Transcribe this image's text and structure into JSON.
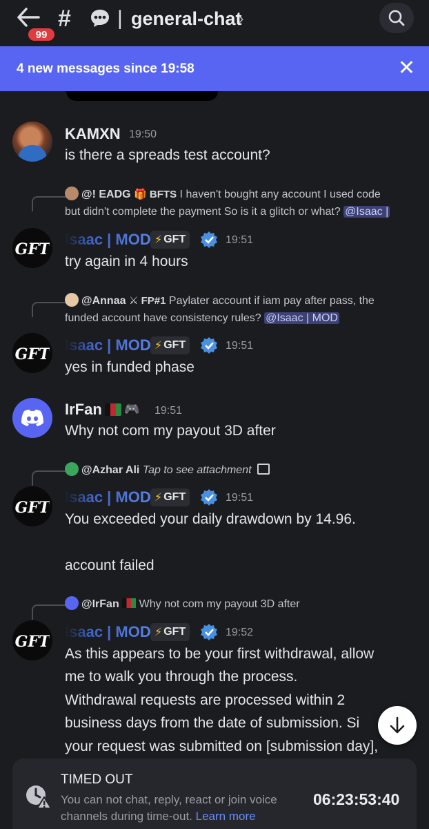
{
  "header": {
    "unread_count": "99",
    "hash": "#",
    "separator": "|",
    "channel_name": "general-chat",
    "chevron": "›"
  },
  "banner": {
    "text": "4 new messages since 19:58",
    "close": "✕"
  },
  "messages": [
    {
      "author": "KAMXN",
      "time": "19:50",
      "lines": [
        "is there a spreads test account?"
      ]
    },
    {
      "reply": {
        "author": "@! EADG",
        "tag": "BFTS",
        "line1": "I haven't bought any account  I used code",
        "line2": "but didn't complete the payment So is it a glitch or what?",
        "mention": "@Isaac |"
      },
      "author": "Isaac | MOD",
      "tag": "GFT",
      "time": "19:51",
      "lines": [
        "try again in 4 hours"
      ]
    },
    {
      "reply": {
        "author": "@Annaa",
        "tag": "FP#1",
        "line1": "Paylater account if iam pay after pass, the",
        "line2": "funded account have consistency rules?",
        "mention": "@Isaac | MOD"
      },
      "author": "Isaac | MOD",
      "tag": "GFT",
      "time": "19:51",
      "lines": [
        "yes in funded phase"
      ]
    },
    {
      "author": "IrFan",
      "time": "19:51",
      "lines": [
        "Why not com my payout 3D after"
      ]
    },
    {
      "reply": {
        "author": "@Azhar Ali",
        "line1": "Tap to see attachment"
      },
      "author": "Isaac | MOD",
      "tag": "GFT",
      "time": "19:51",
      "lines": [
        "You exceeded your daily drawdown by 14.96.",
        "account failed"
      ]
    },
    {
      "reply": {
        "author": "@IrFan",
        "line1": "Why not com my payout 3D after"
      },
      "author": "Isaac | MOD",
      "tag": "GFT",
      "time": "19:52",
      "lines": [
        "As this appears to be your first withdrawal, allow",
        "me to walk you through the process.",
        "Withdrawal requests are processed within 2",
        "business days from the date of submission. Si",
        "your request was submitted on [submission day],"
      ]
    }
  ],
  "timeout": {
    "title": "TIMED OUT",
    "desc": "You can not chat, reply, react or join voice channels during time-out.",
    "link": "Learn more",
    "timer": "06:23:53:40"
  },
  "colors": {
    "banner": "#5865f2",
    "background": "#1b1c20",
    "mod_name": "#5a82e8",
    "badge": "#e03c40"
  }
}
